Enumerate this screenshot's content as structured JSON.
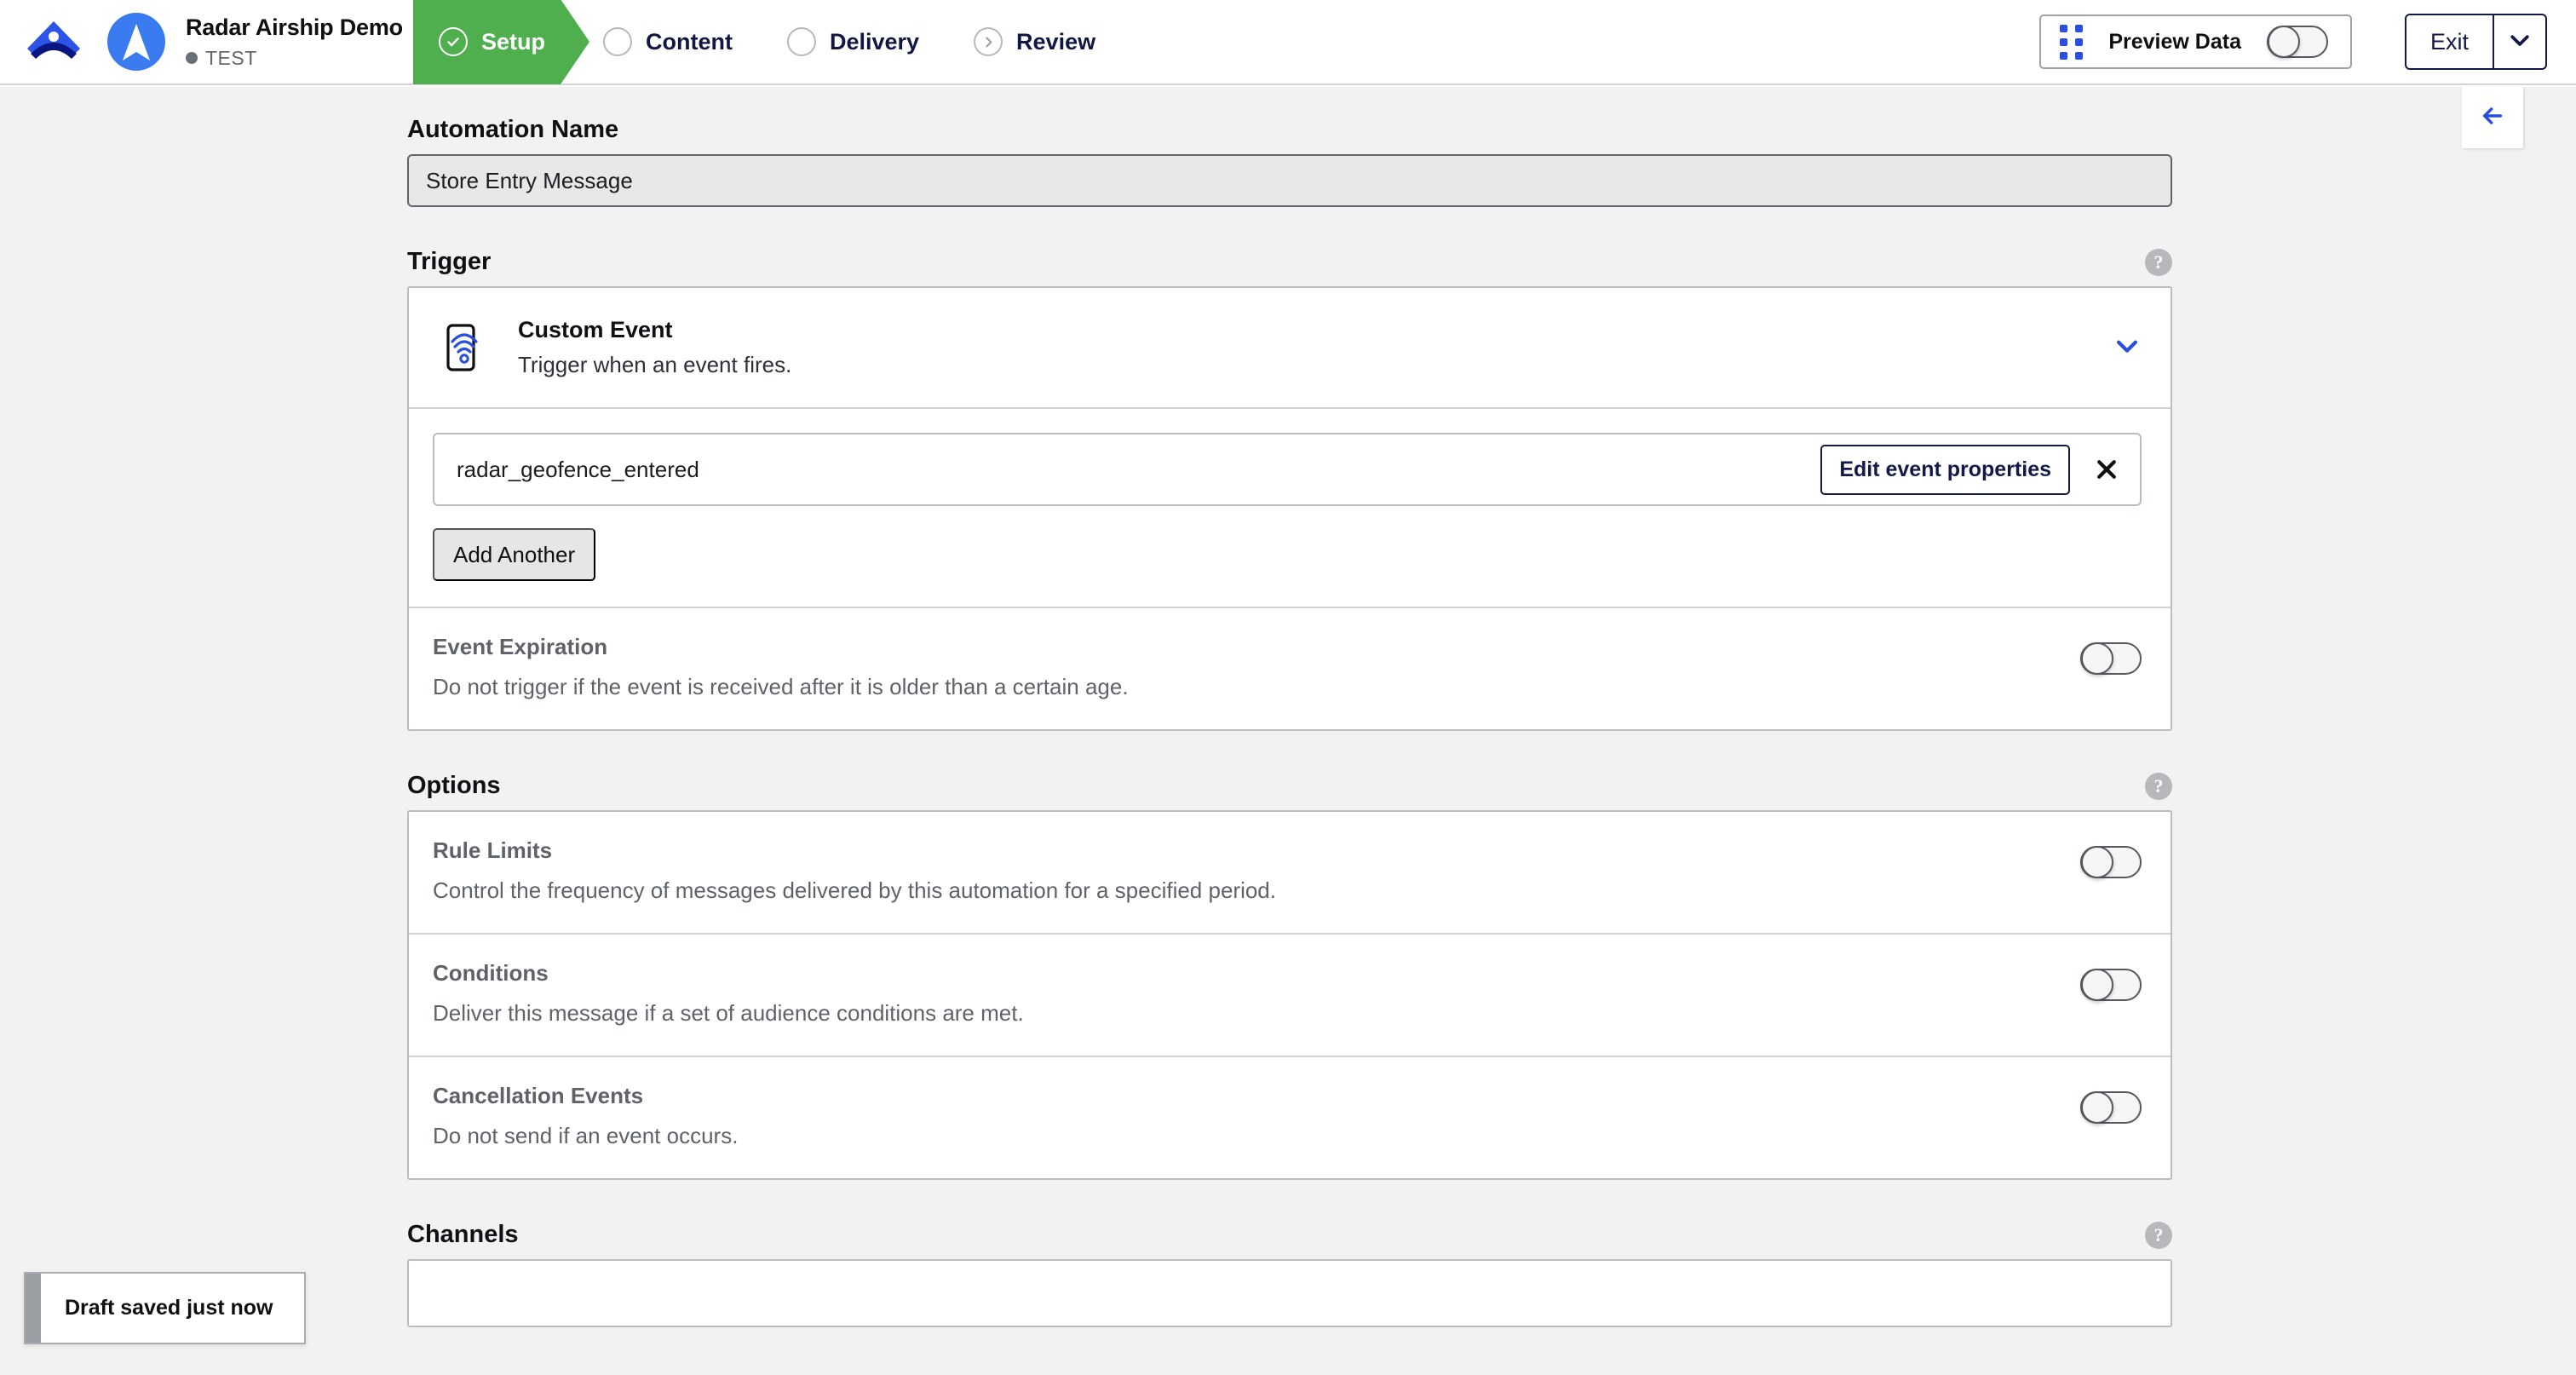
{
  "header": {
    "brand_logo": "airship-logo",
    "app_icon": "radar-app-icon",
    "app_name": "Radar Airship Demo",
    "environment": "TEST",
    "steps": [
      {
        "label": "Setup",
        "icon": "check-circle-icon",
        "state": "active"
      },
      {
        "label": "Content",
        "icon": "empty-circle-icon",
        "state": "upcoming"
      },
      {
        "label": "Delivery",
        "icon": "empty-circle-icon",
        "state": "upcoming"
      },
      {
        "label": "Review",
        "icon": "chevron-right-circle-icon",
        "state": "upcoming"
      }
    ],
    "preview_data": {
      "label": "Preview Data",
      "icon": "grip-dots-icon",
      "toggle": "off"
    },
    "exit": {
      "label": "Exit",
      "caret_icon": "chevron-down-icon"
    }
  },
  "page": {
    "collapse_button_icon": "arrow-left-icon",
    "automation_name": {
      "label": "Automation Name",
      "value": "Store Entry Message"
    },
    "trigger": {
      "section_title": "Trigger",
      "help_icon": "question-mark-icon",
      "card": {
        "icon": "phone-broadcast-icon",
        "title": "Custom Event",
        "subtitle": "Trigger when an event fires.",
        "collapse_icon": "chevron-down-icon"
      },
      "event": {
        "name": "radar_geofence_entered",
        "edit_button": "Edit event properties",
        "remove_icon": "close-x-icon"
      },
      "add_another": "Add Another",
      "expiration": {
        "title": "Event Expiration",
        "description": "Do not trigger if the event is received after it is older than a certain age.",
        "toggle": "off"
      }
    },
    "options": {
      "section_title": "Options",
      "help_icon": "question-mark-icon",
      "rows": [
        {
          "title": "Rule Limits",
          "description": "Control the frequency of messages delivered by this automation for a specified period.",
          "toggle": "off"
        },
        {
          "title": "Conditions",
          "description": "Deliver this message if a set of audience conditions are met.",
          "toggle": "off"
        },
        {
          "title": "Cancellation Events",
          "description": "Do not send if an event occurs.",
          "toggle": "off"
        }
      ]
    },
    "channels": {
      "section_title": "Channels",
      "help_icon": "question-mark-icon"
    },
    "toast": {
      "message": "Draft saved just now"
    }
  },
  "colors": {
    "active_step_green": "#4faf4e",
    "brand_navy": "#15194a",
    "accent_blue": "#2a4fe0",
    "radar_blue": "#3b7bf0",
    "page_background": "#f2f2f2",
    "muted_text": "#5f6369"
  }
}
